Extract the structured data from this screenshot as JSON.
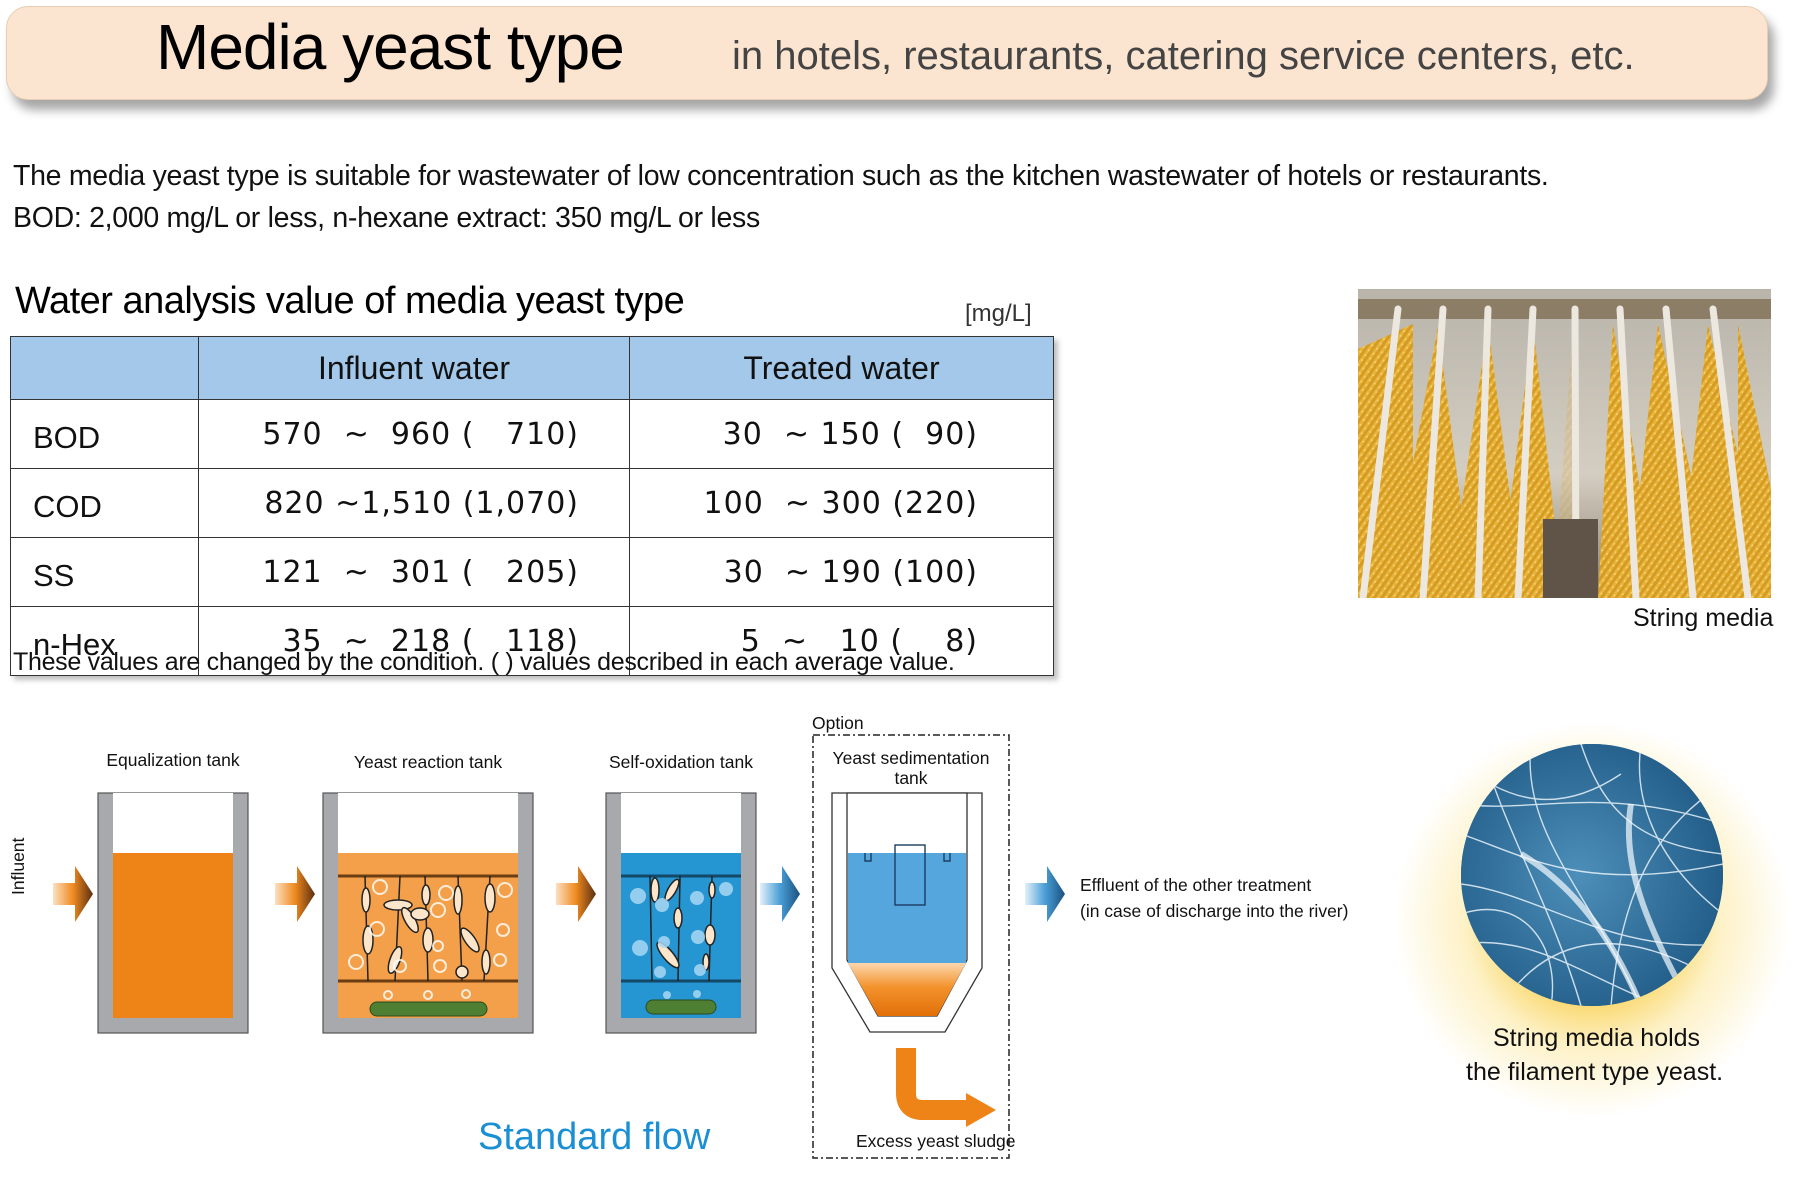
{
  "header": {
    "title": "Media yeast type",
    "subtitle": "in hotels, restaurants, catering service centers, etc."
  },
  "intro": {
    "line1": "The media yeast type is suitable for wastewater of low concentration such as the kitchen wastewater of hotels or restaurants.",
    "line2": "BOD: 2,000 mg/L or less, n-hexane extract: 350 mg/L or less"
  },
  "analysis_table": {
    "title": "Water analysis value of media yeast type",
    "unit": "[mg/L]",
    "columns": [
      "",
      "Influent water",
      "Treated water"
    ],
    "rows": [
      {
        "parameter": "BOD",
        "influent": "570  ~  960 (   710)",
        "treated": "30  ~ 150 (  90)"
      },
      {
        "parameter": "COD",
        "influent": "820 ~1,510 (1,070)",
        "treated": "100  ~ 300 (220)"
      },
      {
        "parameter": "SS",
        "influent": "121  ~  301 (   205)",
        "treated": "30  ~ 190 (100)"
      },
      {
        "parameter": "n-Hex",
        "influent": "35  ~  218 (   118)",
        "treated": "5  ~   10 (    8)"
      }
    ],
    "note": "These values are changed by the condition. (  ) values described in each average value."
  },
  "photos": {
    "string_media_caption": "String media",
    "microscope_caption_line1": "String media holds",
    "microscope_caption_line2": "the filament type yeast."
  },
  "flow": {
    "title": "Standard flow",
    "influent_label": "Influent",
    "tanks": [
      {
        "label": "Equalization tank"
      },
      {
        "label": "Yeast reaction tank"
      },
      {
        "label": "Self-oxidation tank"
      },
      {
        "label_line1": "Yeast sedimentation",
        "label_line2": "tank"
      }
    ],
    "option_label": "Option",
    "sludge_label": "Excess yeast sludge",
    "effluent_line1": "Effluent of the other treatment",
    "effluent_line2": "(in case of discharge into the river)"
  },
  "colors": {
    "banner_bg": "#fce5d0",
    "table_header": "#a3c8ea",
    "influent_orange": "#ee8418",
    "reaction_orange": "#f4a04a",
    "oxidation_blue": "#2596d2",
    "sedimentation_blue": "#55a6dc",
    "diffuser_green": "#4f7f33",
    "tank_wall": "#a7a9ac",
    "standard_flow_text": "#1b8fd4"
  }
}
